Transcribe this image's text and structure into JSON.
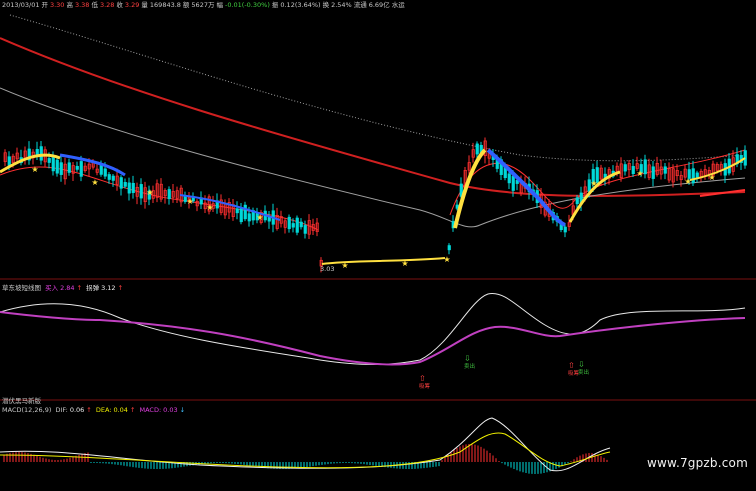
{
  "main_header": {
    "date": "2013/03/01",
    "open_label": "开",
    "open": "3.30",
    "high_label": "高",
    "high": "3.38",
    "low_label": "低",
    "low": "3.28",
    "close_label": "收",
    "close": "3.29",
    "volume_label": "量",
    "volume": "169843.8",
    "amount_label": "额",
    "amount": "5627万",
    "change_label": "幅",
    "change": "-0.01(-0.30%)",
    "amplitude_label": "振",
    "amplitude": "0.12(3.64%)",
    "turnover_label": "换",
    "turnover": "2.54%",
    "float_label": "流通",
    "float": "6.69亿",
    "note": "水运"
  },
  "low_price_label": "3.03",
  "indicator_panel": {
    "name": "草东坡短线图",
    "buy_label": "买入",
    "buy_value": "2.84",
    "sell_label": "拐弹",
    "sell_value": "3.12",
    "buy_color": "#e040e0",
    "sell_color": "#f0f0f0",
    "markers": [
      {
        "text": "吸筹",
        "color": "#ff4040"
      },
      {
        "text": "卖出",
        "color": "#40c040"
      },
      {
        "text": "吸筹",
        "color": "#ff4040"
      },
      {
        "text": "卖出",
        "color": "#40c040"
      }
    ]
  },
  "macd_panel": {
    "title": "潜伏黑马新版",
    "name": "MACD(12,26,9)",
    "dif_label": "DIF:",
    "dif": "0.06",
    "dea_label": "DEA:",
    "dea": "0.04",
    "macd_label": "MACD:",
    "macd": "0.03",
    "dif_color": "#f0f0f0",
    "dea_color": "#f0f000",
    "macd_color": "#e040e0"
  },
  "watermark": "www.7gpzb.com",
  "colors": {
    "background": "#000000",
    "up_candle": "#ff3030",
    "down_candle": "#00d8d8",
    "ma_red": "#d02020",
    "ma_gray": "#a0a0a0",
    "ma_dotted": "#a0a0a0",
    "band_yellow": "#ffe040",
    "band_blue": "#3060ff",
    "purple_line": "#c040c0"
  },
  "chart_data": {
    "type": "candlestick",
    "date_shown": "2013/03/01",
    "panels": [
      "price",
      "短线指标",
      "MACD"
    ],
    "price_series": {
      "open": 3.3,
      "high": 3.38,
      "low": 3.28,
      "close": 3.29,
      "visible_low": 3.03
    },
    "indicator_values": {
      "买入": 2.84,
      "拐弹": 3.12
    },
    "macd_values": {
      "DIF": 0.06,
      "DEA": 0.04,
      "MACD": 0.03
    }
  }
}
